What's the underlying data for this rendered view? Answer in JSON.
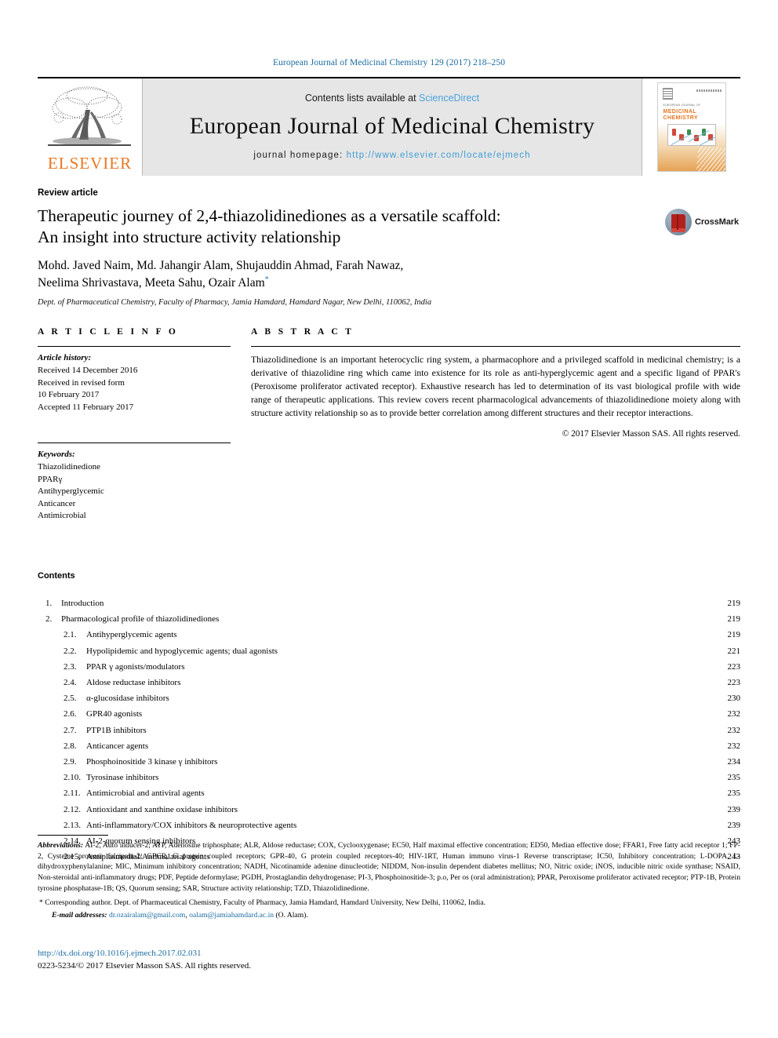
{
  "running_head": "European Journal of Medicinal Chemistry 129 (2017) 218–250",
  "masthead": {
    "publisher_name": "ELSEVIER",
    "contents_prefix": "Contents lists available at ",
    "contents_link": "ScienceDirect",
    "journal_title": "European Journal of Medicinal Chemistry",
    "homepage_label": "journal homepage: ",
    "homepage_url": "http://www.elsevier.com/locate/ejmech",
    "cover": {
      "top_line": "EUROPEAN JOURNAL OF",
      "title_line1": "MEDICINAL",
      "title_line2": "CHEMISTRY"
    }
  },
  "article": {
    "type": "Review article",
    "title_line1": "Therapeutic journey of 2,4-thiazolidinediones as a versatile scaffold:",
    "title_line2": "An insight into structure activity relationship",
    "authors_line1": "Mohd. Javed Naim, Md. Jahangir Alam, Shujauddin Ahmad, Farah Nawaz,",
    "authors_line2": "Neelima Shrivastava, Meeta Sahu, Ozair Alam",
    "corresponding_marker": "*",
    "affiliation": "Dept. of Pharmaceutical Chemistry, Faculty of Pharmacy, Jamia Hamdard, Hamdard Nagar, New Delhi, 110062, India",
    "crossmark_label": "CrossMark"
  },
  "article_info": {
    "heading": "A R T I C L E   I N F O",
    "history_label": "Article history:",
    "history": [
      "Received 14 December 2016",
      "Received in revised form",
      "10 February 2017",
      "Accepted 11 February 2017"
    ],
    "keywords_label": "Keywords:",
    "keywords": [
      "Thiazolidinedione",
      "PPARγ",
      "Antihyperglycemic",
      "Anticancer",
      "Antimicrobial"
    ]
  },
  "abstract": {
    "heading": "A B S T R A C T",
    "body": "Thiazolidinedione is an important heterocyclic ring system, a pharmacophore and a privileged scaffold in medicinal chemistry; is a derivative of thiazolidine ring which came into existence for its role as anti-hyperglycemic agent and a specific ligand of PPAR's (Peroxisome proliferator activated receptor). Exhaustive research has led to determination of its vast biological profile with wide range of therapeutic applications. This review covers recent pharmacological advancements of thiazolidinedione moiety along with structure activity relationship so as to provide better correlation among different structures and their receptor interactions.",
    "copyright": "© 2017 Elsevier Masson SAS. All rights reserved."
  },
  "contents": {
    "heading": "Contents",
    "items": [
      {
        "num": "1.",
        "level": 1,
        "label": "Introduction",
        "page": "219"
      },
      {
        "num": "2.",
        "level": 1,
        "label": "Pharmacological profile of thiazolidinediones",
        "page": "219"
      },
      {
        "num": "2.1.",
        "level": 2,
        "label": "Antihyperglycemic agents",
        "page": "219"
      },
      {
        "num": "2.2.",
        "level": 2,
        "label": "Hypolipidemic and hypoglycemic agents; dual agonists",
        "page": "221"
      },
      {
        "num": "2.3.",
        "level": 2,
        "label": "PPAR γ agonists/modulators",
        "page": "223"
      },
      {
        "num": "2.4.",
        "level": 2,
        "label": "Aldose reductase inhibitors",
        "page": "223"
      },
      {
        "num": "2.5.",
        "level": 2,
        "label": "α-glucosidase inhibitors",
        "page": "230"
      },
      {
        "num": "2.6.",
        "level": 2,
        "label": "GPR40 agonists",
        "page": "232"
      },
      {
        "num": "2.7.",
        "level": 2,
        "label": "PTP1B inhibitors",
        "page": "232"
      },
      {
        "num": "2.8.",
        "level": 2,
        "label": "Anticancer agents",
        "page": "232"
      },
      {
        "num": "2.9.",
        "level": 2,
        "label": "Phosphoinositide 3 kinase γ inhibitors",
        "page": "234"
      },
      {
        "num": "2.10.",
        "level": 2,
        "label": "Tyrosinase inhibitors",
        "page": "235"
      },
      {
        "num": "2.11.",
        "level": 2,
        "label": "Antimicrobial and antiviral agents",
        "page": "235"
      },
      {
        "num": "2.12.",
        "level": 2,
        "label": "Antioxidant and xanthine oxidase inhibitors",
        "page": "239"
      },
      {
        "num": "2.13.",
        "level": 2,
        "label": "Anti-inflammatory/COX inhibitors & neuroprotective agents",
        "page": "239"
      },
      {
        "num": "2.14.",
        "level": 2,
        "label": "AI-2-quorum sensing inhibitors",
        "page": "243"
      },
      {
        "num": "2.15.",
        "level": 2,
        "label": "Antiplasmodial/Antimalarial agents",
        "page": "243"
      }
    ]
  },
  "footnotes": {
    "abbrev_label": "Abbreviations:",
    "abbrev_body": " AI-2, Auto inducer-2; ATP, Adenosine triphosphate; ALR, Aldose reductase; COX, Cyclooxygenase; EC50, Half maximal effective concentration; ED50, Median effective dose; FFAR1, Free fatty acid receptor 1; FP-2, Cysteine protease falcipain-2; GPCR, G protein coupled receptors; GPR-40, G protein coupled receptors-40; HIV-1RT, Human immuno virus-1 Reverse transcriptase; IC50, Inhibitory concentration; L-DOPA, L-dihydroxyphenylalanine; MIC, Minimum inhibitory concentration; NADH, Nicotinamide adenine dinucleotide; NIDDM, Non-insulin dependent diabetes mellitus; NO, Nitric oxide; iNOS, inducible nitric oxide synthase; NSAID, Non-steroidal anti-inflammatory drugs; PDF, Peptide deformylase; PGDH, Prostaglandin dehydrogenase; PI-3, Phosphoinositide-3; p.o, Per os (oral administration); PPAR, Peroxisome proliferator activated receptor; PTP-1B, Protein tyrosine phosphatase-1B; QS, Quorum sensing; SAR, Structure activity relationship; TZD, Thiazolidinedione.",
    "corresponding": "* Corresponding author. Dept. of Pharmaceutical Chemistry, Faculty of Pharmacy, Jamia Hamdard, Hamdard University, New Delhi, 110062, India.",
    "email_label": "E-mail addresses:",
    "email1": "dr.ozairalam@gmail.com",
    "email2": "oalam@jamiahamdard.ac.in",
    "email_suffix": "(O. Alam)."
  },
  "footer": {
    "doi": "http://dx.doi.org/10.1016/j.ejmech.2017.02.031",
    "issn_copyright": "0223-5234/© 2017 Elsevier Masson SAS. All rights reserved."
  },
  "colors": {
    "link_blue": "#1a6ba0",
    "sciencedirect_blue": "#4aa3df",
    "elsevier_orange": "#E87722",
    "crossmark_red": "#b4201c"
  }
}
